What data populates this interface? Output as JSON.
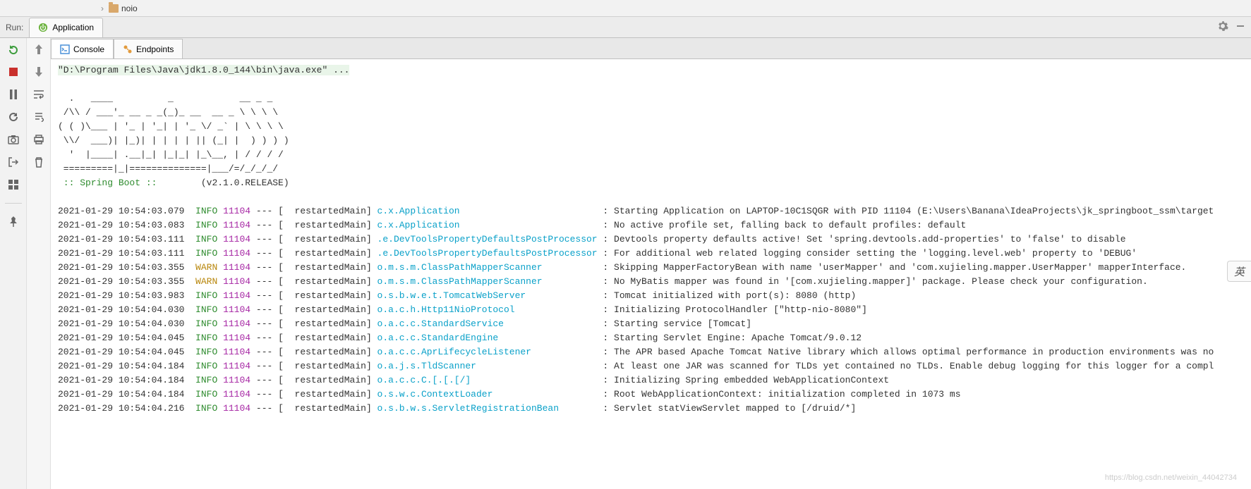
{
  "top": {
    "folder_name": "noio"
  },
  "run": {
    "label": "Run:",
    "app_name": "Application"
  },
  "tabs": {
    "console": "Console",
    "endpoints": "Endpoints"
  },
  "cmd": "\"D:\\Program Files\\Java\\jdk1.8.0_144\\bin\\java.exe\" ...",
  "banner": "  .   ____          _            __ _ _\n /\\\\ / ___'_ __ _ _(_)_ __  __ _ \\ \\ \\ \\\n( ( )\\___ | '_ | '_| | '_ \\/ _` | \\ \\ \\ \\\n \\\\/  ___)| |_)| | | | | || (_| |  ) ) ) )\n  '  |____| .__|_| |_|_| |_\\__, | / / / /\n =========|_|==============|___/=/_/_/_/",
  "sb_label": " :: Spring Boot :: ",
  "sb_version": "       (v2.1.0.RELEASE)",
  "logs": [
    {
      "ts": "2021-01-29 10:54:03.079",
      "lvl": "INFO",
      "pid": "11104",
      "thread": "restartedMain",
      "logger": "c.x.Application",
      "msg": "Starting Application on LAPTOP-10C1SQGR with PID 11104 (E:\\Users\\Banana\\IdeaProjects\\jk_springboot_ssm\\target"
    },
    {
      "ts": "2021-01-29 10:54:03.083",
      "lvl": "INFO",
      "pid": "11104",
      "thread": "restartedMain",
      "logger": "c.x.Application",
      "msg": "No active profile set, falling back to default profiles: default"
    },
    {
      "ts": "2021-01-29 10:54:03.111",
      "lvl": "INFO",
      "pid": "11104",
      "thread": "restartedMain",
      "logger": ".e.DevToolsPropertyDefaultsPostProcessor",
      "msg": "Devtools property defaults active! Set 'spring.devtools.add-properties' to 'false' to disable"
    },
    {
      "ts": "2021-01-29 10:54:03.111",
      "lvl": "INFO",
      "pid": "11104",
      "thread": "restartedMain",
      "logger": ".e.DevToolsPropertyDefaultsPostProcessor",
      "msg": "For additional web related logging consider setting the 'logging.level.web' property to 'DEBUG'"
    },
    {
      "ts": "2021-01-29 10:54:03.355",
      "lvl": "WARN",
      "pid": "11104",
      "thread": "restartedMain",
      "logger": "o.m.s.m.ClassPathMapperScanner",
      "msg": "Skipping MapperFactoryBean with name 'userMapper' and 'com.xujieling.mapper.UserMapper' mapperInterface."
    },
    {
      "ts": "2021-01-29 10:54:03.355",
      "lvl": "WARN",
      "pid": "11104",
      "thread": "restartedMain",
      "logger": "o.m.s.m.ClassPathMapperScanner",
      "msg": "No MyBatis mapper was found in '[com.xujieling.mapper]' package. Please check your configuration."
    },
    {
      "ts": "2021-01-29 10:54:03.983",
      "lvl": "INFO",
      "pid": "11104",
      "thread": "restartedMain",
      "logger": "o.s.b.w.e.t.TomcatWebServer",
      "msg": "Tomcat initialized with port(s): 8080 (http)"
    },
    {
      "ts": "2021-01-29 10:54:04.030",
      "lvl": "INFO",
      "pid": "11104",
      "thread": "restartedMain",
      "logger": "o.a.c.h.Http11NioProtocol",
      "msg": "Initializing ProtocolHandler [\"http-nio-8080\"]"
    },
    {
      "ts": "2021-01-29 10:54:04.030",
      "lvl": "INFO",
      "pid": "11104",
      "thread": "restartedMain",
      "logger": "o.a.c.c.StandardService",
      "msg": "Starting service [Tomcat]"
    },
    {
      "ts": "2021-01-29 10:54:04.045",
      "lvl": "INFO",
      "pid": "11104",
      "thread": "restartedMain",
      "logger": "o.a.c.c.StandardEngine",
      "msg": "Starting Servlet Engine: Apache Tomcat/9.0.12"
    },
    {
      "ts": "2021-01-29 10:54:04.045",
      "lvl": "INFO",
      "pid": "11104",
      "thread": "restartedMain",
      "logger": "o.a.c.c.AprLifecycleListener",
      "msg": "The APR based Apache Tomcat Native library which allows optimal performance in production environments was no"
    },
    {
      "ts": "2021-01-29 10:54:04.184",
      "lvl": "INFO",
      "pid": "11104",
      "thread": "restartedMain",
      "logger": "o.a.j.s.TldScanner",
      "msg": "At least one JAR was scanned for TLDs yet contained no TLDs. Enable debug logging for this logger for a compl"
    },
    {
      "ts": "2021-01-29 10:54:04.184",
      "lvl": "INFO",
      "pid": "11104",
      "thread": "restartedMain",
      "logger": "o.a.c.c.C.[.[.[/]",
      "msg": "Initializing Spring embedded WebApplicationContext"
    },
    {
      "ts": "2021-01-29 10:54:04.184",
      "lvl": "INFO",
      "pid": "11104",
      "thread": "restartedMain",
      "logger": "o.s.w.c.ContextLoader",
      "msg": "Root WebApplicationContext: initialization completed in 1073 ms"
    },
    {
      "ts": "2021-01-29 10:54:04.216",
      "lvl": "INFO",
      "pid": "11104",
      "thread": "restartedMain",
      "logger": "o.s.b.w.s.ServletRegistrationBean",
      "msg": "Servlet statViewServlet mapped to [/druid/*]"
    }
  ],
  "watermark": "https://blog.csdn.net/weixin_44042734",
  "lang_badge": "英"
}
